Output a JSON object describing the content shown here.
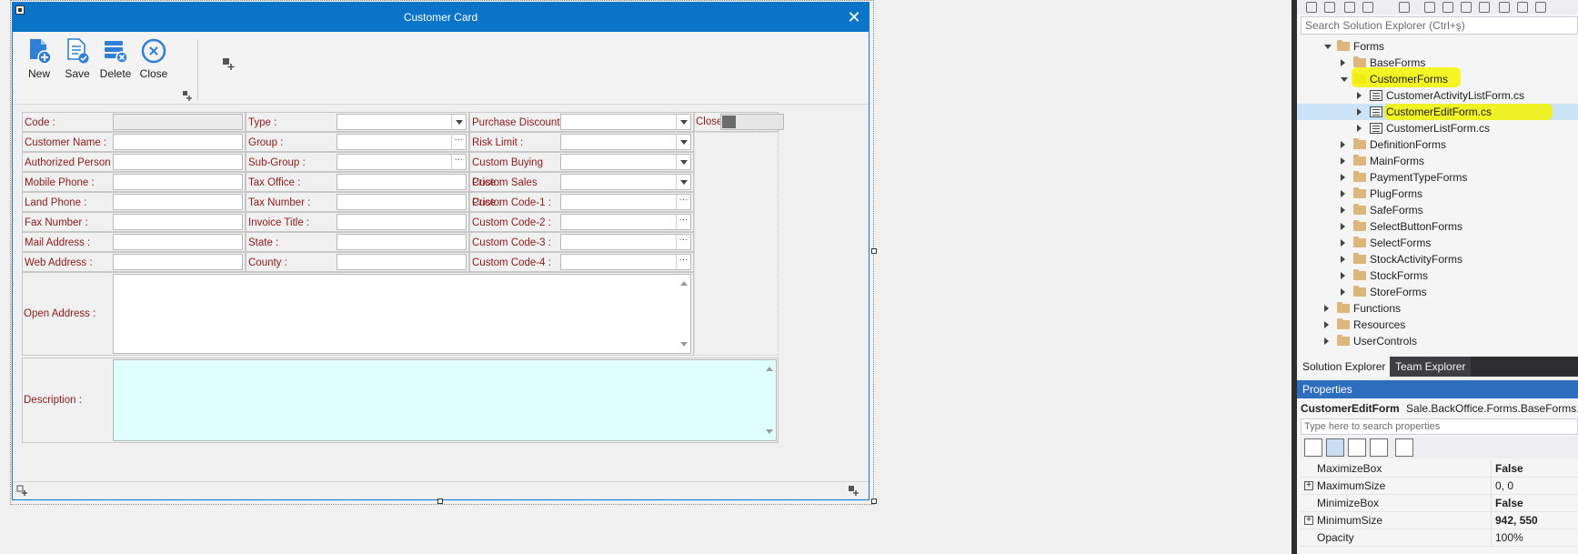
{
  "form": {
    "title": "Customer Card",
    "toolbar": {
      "new_label": "New",
      "save_label": "Save",
      "delete_label": "Delete",
      "close_label": "Close"
    },
    "fields": {
      "col1": [
        "Code :",
        "Customer Name :",
        "Authorized Person :",
        "Mobile Phone :",
        "Land Phone :",
        "Fax Number :",
        "Mail Address :",
        "Web Address :"
      ],
      "col2": [
        "Type :",
        "Group :",
        "Sub-Group :",
        "Tax Office :",
        "Tax Number :",
        "Invoice Title :",
        "State :",
        "County :"
      ],
      "col3": [
        "Purchase Discount :",
        "Risk Limit :",
        "Custom Buying Price :",
        "Custom Sales Price :",
        "Custom Code-1 :",
        "Custom Code-2 :",
        "Custom Code-3 :",
        "Custom Code-4 :"
      ],
      "open_address": "Open Address :",
      "description": "Description :",
      "close_toggle": "Close"
    },
    "accent": "#0a74c8",
    "label_color": "#8b1a1a"
  },
  "solution_explorer": {
    "search_placeholder": "Search Solution Explorer (Ctrl+ş)",
    "tree": [
      {
        "label": "Forms",
        "level": 0,
        "kind": "folder",
        "state": "open"
      },
      {
        "label": "BaseForms",
        "level": 1,
        "kind": "folder",
        "state": "closed"
      },
      {
        "label": "CustomerForms",
        "level": 1,
        "kind": "folder",
        "state": "open"
      },
      {
        "label": "CustomerActivityListForm.cs",
        "level": 2,
        "kind": "file",
        "state": "closed"
      },
      {
        "label": "CustomerEditForm.cs",
        "level": 2,
        "kind": "file",
        "state": "closed"
      },
      {
        "label": "CustomerListForm.cs",
        "level": 2,
        "kind": "file",
        "state": "closed"
      },
      {
        "label": "DefinitionForms",
        "level": 1,
        "kind": "folder",
        "state": "closed"
      },
      {
        "label": "MainForms",
        "level": 1,
        "kind": "folder",
        "state": "closed"
      },
      {
        "label": "PaymentTypeForms",
        "level": 1,
        "kind": "folder",
        "state": "closed"
      },
      {
        "label": "PlugForms",
        "level": 1,
        "kind": "folder",
        "state": "closed"
      },
      {
        "label": "SafeForms",
        "level": 1,
        "kind": "folder",
        "state": "closed"
      },
      {
        "label": "SelectButtonForms",
        "level": 1,
        "kind": "folder",
        "state": "closed"
      },
      {
        "label": "SelectForms",
        "level": 1,
        "kind": "folder",
        "state": "closed"
      },
      {
        "label": "StockActivityForms",
        "level": 1,
        "kind": "folder",
        "state": "closed"
      },
      {
        "label": "StockForms",
        "level": 1,
        "kind": "folder",
        "state": "closed"
      },
      {
        "label": "StoreForms",
        "level": 1,
        "kind": "folder",
        "state": "closed"
      },
      {
        "label": "Functions",
        "level": 0,
        "kind": "folder",
        "state": "closed"
      },
      {
        "label": "Resources",
        "level": 0,
        "kind": "folder",
        "state": "closed"
      },
      {
        "label": "UserControls",
        "level": 0,
        "kind": "folder",
        "state": "closed"
      }
    ],
    "tabs": [
      "Solution Explorer",
      "Team Explorer"
    ]
  },
  "properties": {
    "title": "Properties",
    "object_name": "CustomerEditForm",
    "object_type": "Sale.BackOffice.Forms.BaseForms.Ba",
    "search_placeholder": "Type here to search properties",
    "rows": [
      {
        "name": "MaximizeBox",
        "value": "False",
        "bold": true,
        "expandable": false
      },
      {
        "name": "MaximumSize",
        "value": "0, 0",
        "bold": false,
        "expandable": true
      },
      {
        "name": "MinimizeBox",
        "value": "False",
        "bold": true,
        "expandable": false
      },
      {
        "name": "MinimumSize",
        "value": "942, 550",
        "bold": true,
        "expandable": true
      },
      {
        "name": "Opacity",
        "value": "100%",
        "bold": false,
        "expandable": false
      }
    ]
  }
}
